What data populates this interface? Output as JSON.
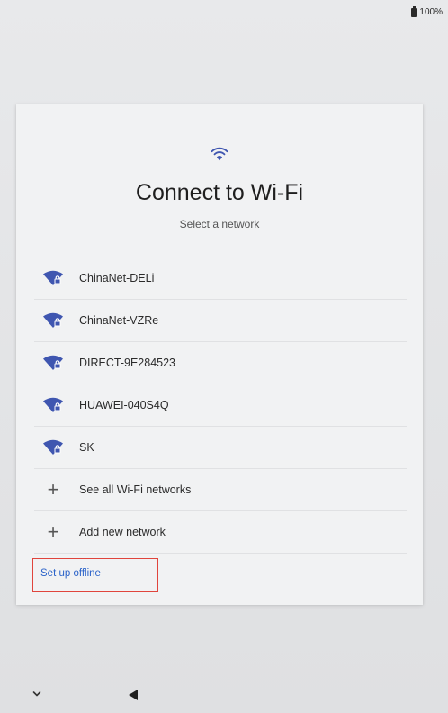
{
  "status_bar": {
    "battery_label": "100%",
    "battery_icon": "battery-full-icon"
  },
  "setup": {
    "header_icon": "wifi-icon",
    "title": "Connect to Wi-Fi",
    "subtitle": "Select a network"
  },
  "networks": [
    {
      "name": "ChinaNet-DELi",
      "icon": "wifi-locked-icon"
    },
    {
      "name": "ChinaNet-VZRe",
      "icon": "wifi-locked-icon"
    },
    {
      "name": "DIRECT-9E284523",
      "icon": "wifi-locked-icon"
    },
    {
      "name": "HUAWEI-040S4Q",
      "icon": "wifi-locked-icon"
    },
    {
      "name": "SK",
      "icon": "wifi-locked-icon"
    }
  ],
  "actions": {
    "see_all": "See all Wi-Fi networks",
    "add_new": "Add new network",
    "offline": "Set up offline"
  },
  "colors": {
    "link": "#2b63c9",
    "wifi_icon": "#3f56b0",
    "highlight_box": "#e0443c"
  },
  "nav_bar": {
    "down_icon": "chevron-down-icon",
    "back_icon": "back-triangle-icon"
  }
}
